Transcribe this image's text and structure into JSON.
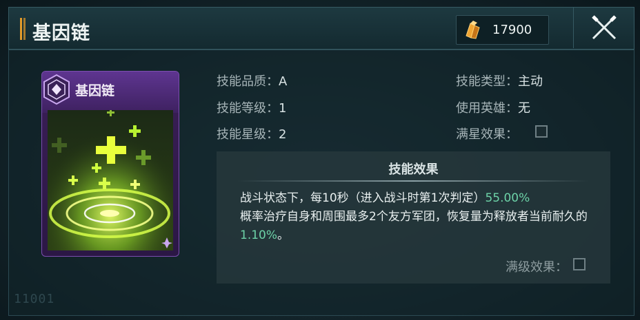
{
  "header": {
    "title": "基因链",
    "currency_value": "17900"
  },
  "card": {
    "title": "基因链",
    "accent_color": "#7c4eb0",
    "glow_color": "#c6ff3a"
  },
  "skill_info": {
    "quality_label": "技能品质：",
    "quality_value": "A",
    "level_label": "技能等级：",
    "level_value": "1",
    "star_label": "技能星级：",
    "star_value": "2",
    "type_label": "技能类型：",
    "type_value": "主动",
    "hero_label": "使用英雄：",
    "hero_value": "无",
    "max_star_label": "满星效果："
  },
  "effect": {
    "title": "技能效果",
    "text_part1": "战斗状态下，每10秒（进入战斗时第1次判定）",
    "highlight1": "55.00%",
    "text_part2": "概率治疗自身和周围最多2个友方军团，恢复量为释放者当前耐久的",
    "highlight2": "1.10%",
    "text_part3": "。",
    "max_level_label": "满级效果："
  },
  "footer": {
    "stamp": "11001"
  }
}
